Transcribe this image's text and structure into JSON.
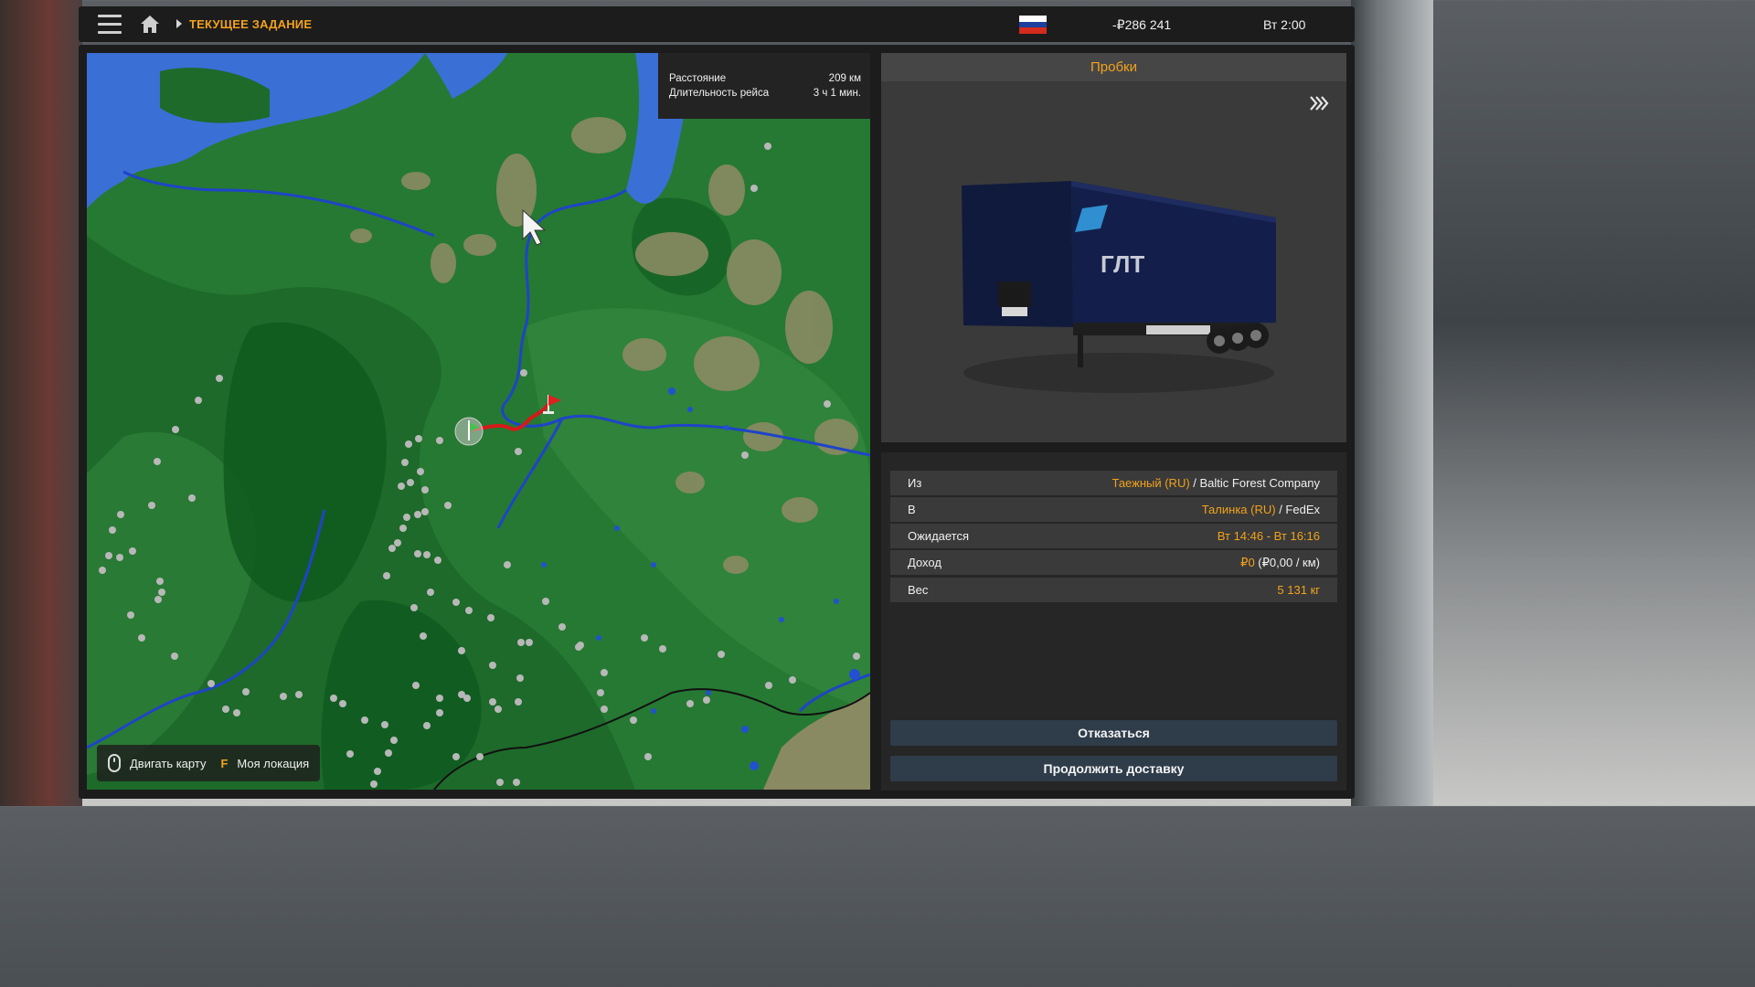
{
  "header": {
    "breadcrumb": "ТЕКУЩЕЕ ЗАДАНИЕ",
    "money": "-₽286 241",
    "time": "Вт 2:00",
    "flag_colors": [
      "#ffffff",
      "#1c3f9e",
      "#d52b1e"
    ],
    "menu_icon": "hamburger-icon",
    "home_icon": "home-icon"
  },
  "route_info": {
    "distance_label": "Расстояние",
    "distance_value": "209 км",
    "duration_label": "Длительность рейса",
    "duration_value": "3 ч 1 мин."
  },
  "map_hints": {
    "move_label": "Двигать карту",
    "location_key": "F",
    "location_label": "Моя локация"
  },
  "cargo_panel": {
    "title": "Пробки",
    "skip_icon": "fast-forward-icon",
    "trailer_brand": "ГЛТ"
  },
  "details": {
    "from_label": "Из",
    "from_city": "Таежный (RU)",
    "from_company": " / Baltic Forest Company",
    "to_label": "В",
    "to_city": "Талинка (RU)",
    "to_company": " / FedEx",
    "expected_label": "Ожидается",
    "expected_value": "Вт 14:46 - Вт 16:16",
    "income_label": "Доход",
    "income_value": "₽0",
    "income_rate": " (₽0,00 / км)",
    "weight_label": "Вес",
    "weight_value": "5 131 кг"
  },
  "buttons": {
    "decline": "Отказаться",
    "continue": "Продолжить доставку"
  },
  "colors": {
    "accent": "#f2a21c",
    "button_bg": "#2f3c4a",
    "route": "#d61a1a"
  }
}
